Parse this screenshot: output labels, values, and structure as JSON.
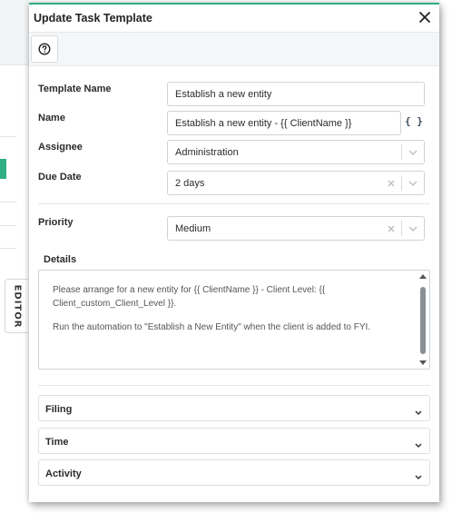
{
  "sidebar": {
    "editor_tab_label": "EDITOR"
  },
  "dialog": {
    "title": "Update Task Template",
    "close_icon": "close-icon",
    "help_icon": "question-circle-icon"
  },
  "form": {
    "template_name": {
      "label": "Template Name",
      "value": "Establish a new entity"
    },
    "name": {
      "label": "Name",
      "value": "Establish a new entity - {{ ClientName }}",
      "variable_button": "{ }"
    },
    "assignee": {
      "label": "Assignee",
      "value": "Administration"
    },
    "due_date": {
      "label": "Due Date",
      "value": "2 days"
    },
    "priority": {
      "label": "Priority",
      "value": "Medium"
    },
    "details": {
      "label": "Details",
      "paragraphs": [
        "Please arrange for a new entity for {{ ClientName }} - Client Level: {{ Client_custom_Client_Level }}.",
        "Run the automation to \"Establish a New Entity\" when the client is added to FYI."
      ]
    }
  },
  "sections": [
    {
      "label": "Filing"
    },
    {
      "label": "Time"
    },
    {
      "label": "Activity"
    }
  ],
  "colors": {
    "accent": "#2fae86",
    "border": "#cfd3d7",
    "toolbar_bg": "#f5f6f7"
  }
}
